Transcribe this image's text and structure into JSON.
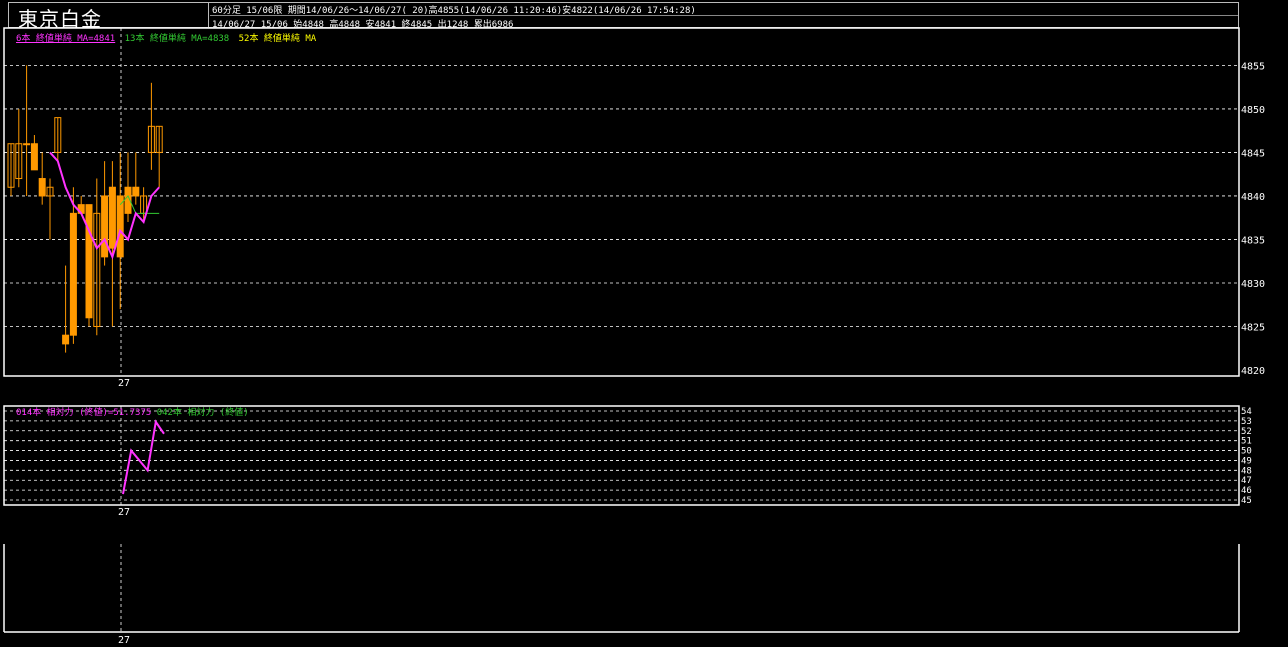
{
  "header": {
    "title": "東京白金",
    "info_line1": "60分足 15/06限  期間14/06/26～14/06/27( 20)高4855(14/06/26 11:20:46)安4822(14/06/26 17:54:28)",
    "info_line2": "14/06/27 15/06 始4848 高4848 安4841 終4845 出1248 累出6986"
  },
  "legend_main": {
    "ma6": "6本 終値単純 MA=4841",
    "ma13": "13本 終値単純 MA=4838",
    "ma52": "52本 終値単純 MA"
  },
  "legend_sub": {
    "rsi14": "014本 相対力 (終値)=51.7375",
    "rsi42": "042本 相対力 (終値)"
  },
  "colors": {
    "candle_up": "#ff9900",
    "candle_down": "#ff9900",
    "wick": "#ff9900",
    "ma6": "#ff33ff",
    "ma13": "#33cc33",
    "ma52": "#ffff00",
    "grid": "#ffffff",
    "frame": "#ffffff",
    "rsi": "#ff33ff"
  },
  "chart_data": [
    {
      "type": "candlestick",
      "title": "東京白金 60分足 15/06限",
      "ylim": [
        4820,
        4857
      ],
      "yticks": [
        4820,
        4825,
        4830,
        4835,
        4840,
        4845,
        4850,
        4855
      ],
      "xtick_label": "27",
      "candles": [
        {
          "o": 4841,
          "h": 4846,
          "l": 4840,
          "c": 4846
        },
        {
          "o": 4842,
          "h": 4850,
          "l": 4841,
          "c": 4846
        },
        {
          "o": 4846,
          "h": 4855,
          "l": 4840,
          "c": 4846
        },
        {
          "o": 4846,
          "h": 4847,
          "l": 4843,
          "c": 4843
        },
        {
          "o": 4842,
          "h": 4845,
          "l": 4839,
          "c": 4840
        },
        {
          "o": 4840,
          "h": 4842,
          "l": 4835,
          "c": 4841
        },
        {
          "o": 4845,
          "h": 4849,
          "l": 4844,
          "c": 4849
        },
        {
          "o": 4824,
          "h": 4832,
          "l": 4822,
          "c": 4823
        },
        {
          "o": 4838,
          "h": 4841,
          "l": 4823,
          "c": 4824
        },
        {
          "o": 4839,
          "h": 4840,
          "l": 4838,
          "c": 4838
        },
        {
          "o": 4839,
          "h": 4839,
          "l": 4825,
          "c": 4826
        },
        {
          "o": 4825,
          "h": 4842,
          "l": 4824,
          "c": 4838
        },
        {
          "o": 4840,
          "h": 4844,
          "l": 4832,
          "c": 4833
        },
        {
          "o": 4841,
          "h": 4844,
          "l": 4825,
          "c": 4834
        },
        {
          "o": 4840,
          "h": 4845,
          "l": 4827,
          "c": 4833
        },
        {
          "o": 4841,
          "h": 4845,
          "l": 4837,
          "c": 4838
        },
        {
          "o": 4841,
          "h": 4845,
          "l": 4839,
          "c": 4840
        },
        {
          "o": 4838,
          "h": 4841,
          "l": 4837,
          "c": 4840
        },
        {
          "o": 4845,
          "h": 4853,
          "l": 4843,
          "c": 4848
        },
        {
          "o": 4845,
          "h": 4848,
          "l": 4841,
          "c": 4848
        }
      ],
      "ma6": [
        null,
        null,
        null,
        null,
        null,
        4845,
        4844,
        4841,
        4839,
        4838,
        4836,
        4834,
        4835,
        4833,
        4836,
        4835,
        4838,
        4837,
        4840,
        4841
      ],
      "ma13": [
        null,
        null,
        null,
        null,
        null,
        null,
        null,
        null,
        null,
        null,
        null,
        null,
        null,
        null,
        4839,
        4840,
        4838,
        4838,
        4838,
        4838
      ]
    },
    {
      "type": "line",
      "title": "相対力 (終値)",
      "ylim": [
        45,
        54
      ],
      "yticks": [
        45,
        46,
        47,
        48,
        49,
        50,
        51,
        52,
        53,
        54
      ],
      "xtick_label": "27",
      "series": [
        {
          "name": "014本 相対力 (終値)",
          "values": [
            45.6,
            50.0,
            49.0,
            48.0,
            52.9,
            51.7
          ]
        }
      ]
    }
  ],
  "lower_panel": {
    "xtick_label": "27"
  }
}
